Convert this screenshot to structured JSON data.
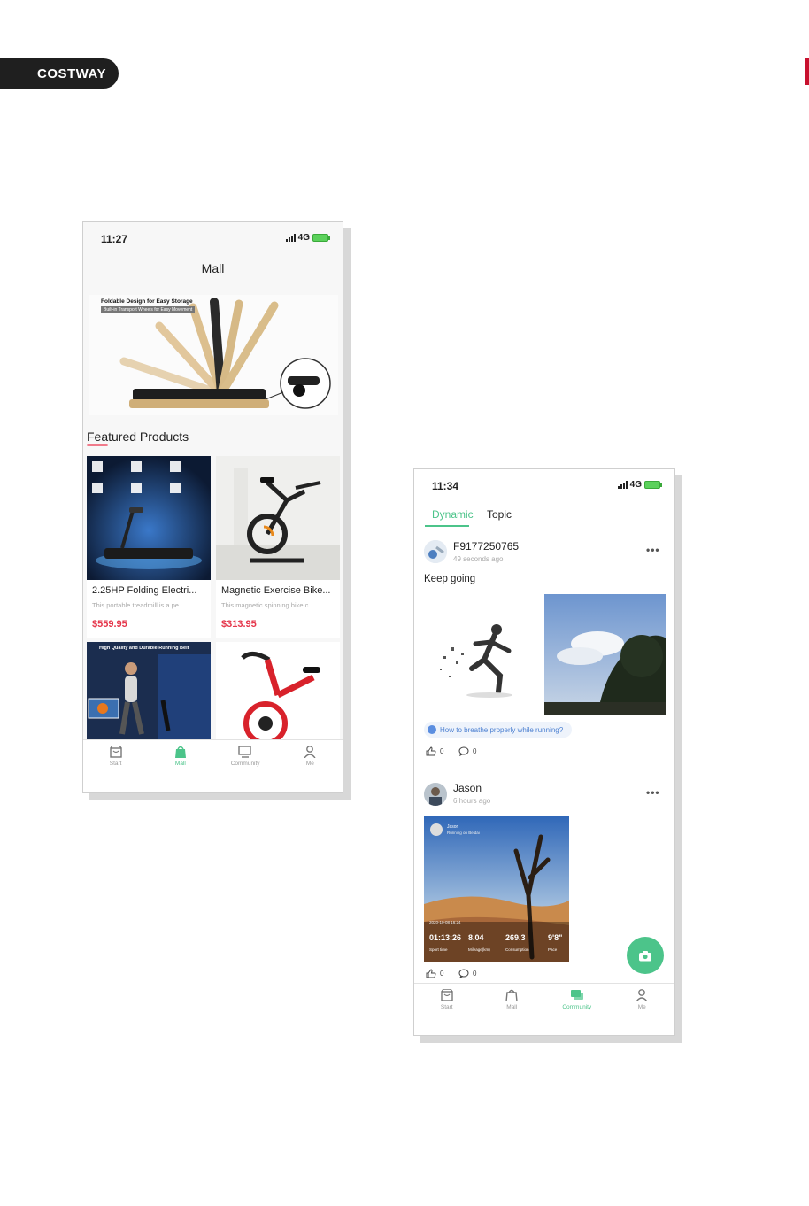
{
  "brand": {
    "label": "COSTWAY"
  },
  "colors": {
    "accent": "#4cc48a",
    "price": "#e5364b",
    "brand_bg": "#1f1f1f"
  },
  "mall_screen": {
    "status": {
      "time": "11:27",
      "network": "4G"
    },
    "title": "Mall",
    "banner": {
      "caption": "Foldable Design for Easy Storage",
      "subcaption": "Built-in Transport Wheels for Easy Movement"
    },
    "section_title": "Featured Products",
    "products": [
      {
        "title": "2.25HP Folding Electri...",
        "desc": "This portable treadmill is a pe...",
        "price": "$559.95",
        "image": "treadmill"
      },
      {
        "title": "Magnetic Exercise Bike...",
        "desc": "This magnetic spinning bike c...",
        "price": "$313.95",
        "image": "exercise-bike"
      },
      {
        "title": "",
        "image_caption": "High Quality and Durable Running Belt",
        "image": "treadmill-runner"
      },
      {
        "title": "",
        "image": "red-bike"
      }
    ],
    "tabs": [
      {
        "label": "Start",
        "icon": "store-icon"
      },
      {
        "label": "Mall",
        "icon": "bag-icon",
        "active": true
      },
      {
        "label": "Community",
        "icon": "monitor-icon"
      },
      {
        "label": "Me",
        "icon": "person-icon"
      }
    ]
  },
  "community_screen": {
    "status": {
      "time": "11:34",
      "network": "4G"
    },
    "segments": [
      {
        "label": "Dynamic",
        "active": true
      },
      {
        "label": "Topic"
      }
    ],
    "posts": [
      {
        "user": "F9177250765",
        "time": "49 seconds ago",
        "text": "Keep going",
        "topic": "How to breathe properly while running?",
        "likes": "0",
        "comments": "0"
      },
      {
        "user": "Jason",
        "time": "6 hours ago",
        "card": {
          "user": "Jason",
          "subtitle": "Running on Beidai",
          "date": "2020-10-08 16:24",
          "stats": [
            {
              "value": "01:13:26",
              "label": "Sport time"
            },
            {
              "value": "8.04",
              "label": "Mileage(km)"
            },
            {
              "value": "269.3",
              "label": "Consumption"
            },
            {
              "value": "9'8\"",
              "label": "Pace"
            }
          ]
        },
        "likes": "0",
        "comments": "0"
      }
    ],
    "tabs": [
      {
        "label": "Start",
        "icon": "store-icon"
      },
      {
        "label": "Mall",
        "icon": "bag-icon"
      },
      {
        "label": "Community",
        "icon": "chat-icon",
        "active": true
      },
      {
        "label": "Me",
        "icon": "person-icon"
      }
    ]
  }
}
